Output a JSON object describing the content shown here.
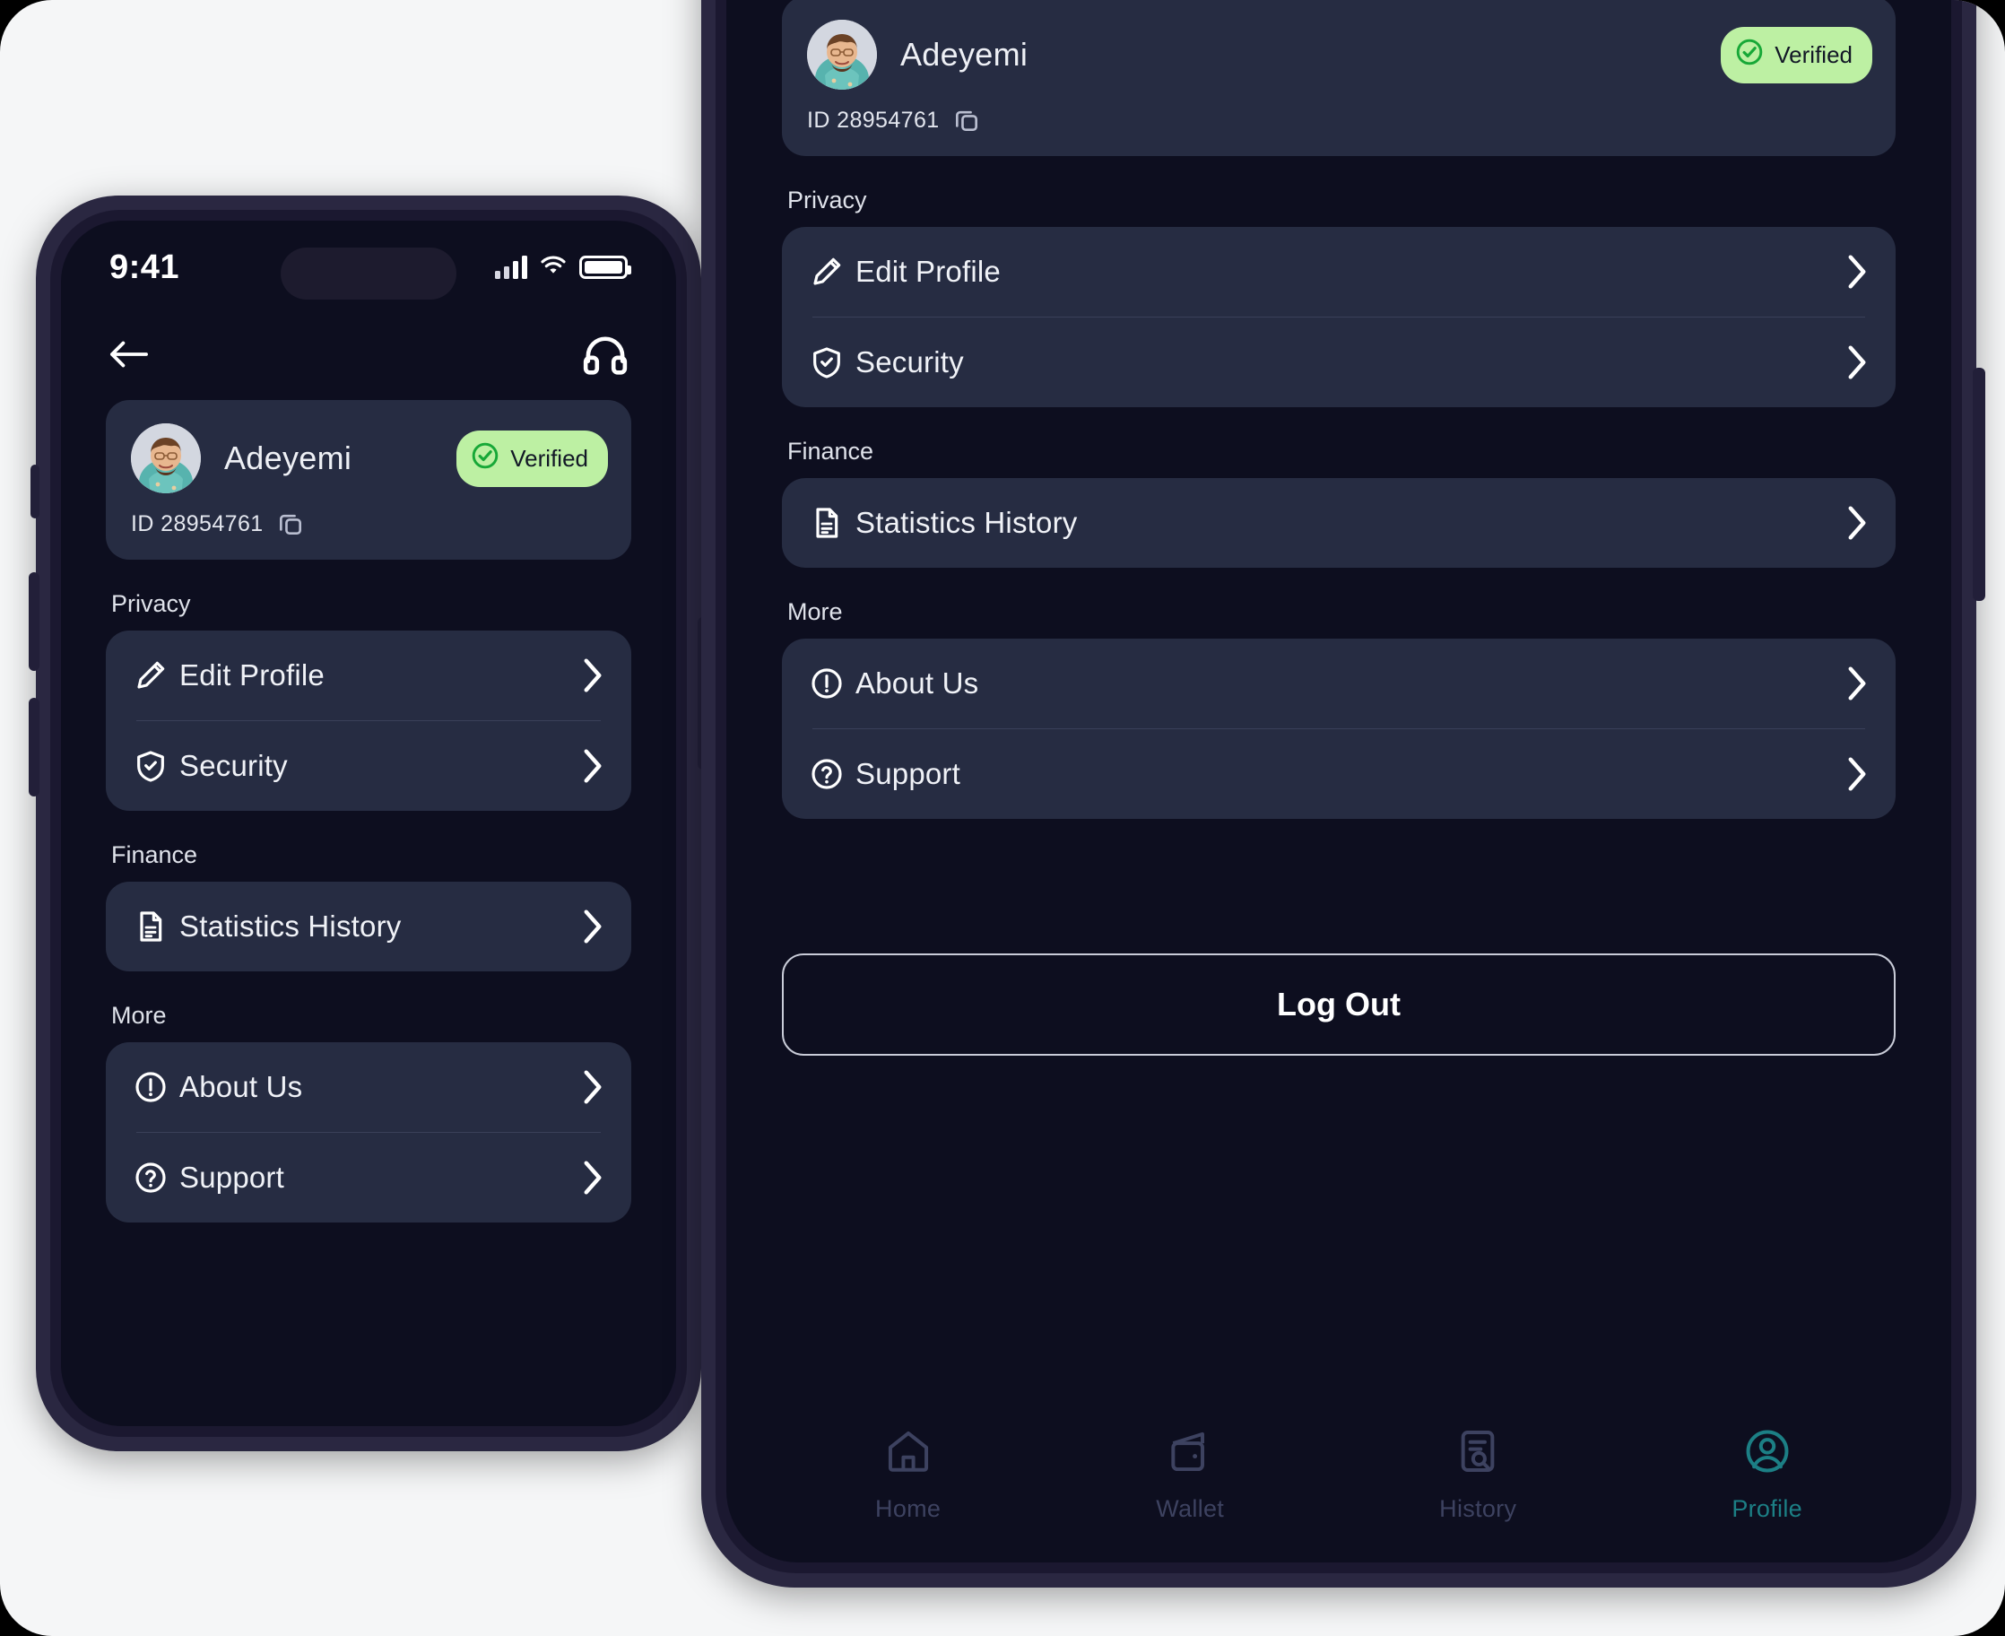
{
  "status_bar": {
    "time": "9:41",
    "signal_icon": "cellular-signal-icon",
    "wifi_icon": "wifi-icon",
    "battery_icon": "battery-icon"
  },
  "header": {
    "back_icon": "back-arrow-icon",
    "support_icon": "headphones-icon"
  },
  "profile": {
    "name": "Adeyemi",
    "id_label": "ID 28954761",
    "copy_icon": "copy-icon",
    "verified_label": "Verified",
    "verified_icon": "check-circle-icon",
    "avatar_icon": "user-avatar-photo"
  },
  "sections": [
    {
      "label": "Privacy",
      "items": [
        {
          "label": "Edit Profile",
          "icon": "pencil-icon",
          "chevron": "chevron-right-icon"
        },
        {
          "label": "Security",
          "icon": "shield-check-icon",
          "chevron": "chevron-right-icon"
        }
      ]
    },
    {
      "label": "Finance",
      "items": [
        {
          "label": "Statistics History",
          "icon": "document-icon",
          "chevron": "chevron-right-icon"
        }
      ]
    },
    {
      "label": "More",
      "items": [
        {
          "label": "About Us",
          "icon": "info-circle-icon",
          "chevron": "chevron-right-icon"
        },
        {
          "label": "Support",
          "icon": "question-circle-icon",
          "chevron": "chevron-right-icon"
        }
      ]
    }
  ],
  "logout": {
    "label": "Log Out"
  },
  "bottom_nav": {
    "items": [
      {
        "label": "Home",
        "icon": "home-icon",
        "active": false
      },
      {
        "label": "Wallet",
        "icon": "wallet-icon",
        "active": false
      },
      {
        "label": "History",
        "icon": "history-search-icon",
        "active": false
      },
      {
        "label": "Profile",
        "icon": "user-circle-icon",
        "active": true
      }
    ]
  },
  "colors": {
    "canvas_bg": "#f5f6f7",
    "phone_frame": "#2a2741",
    "screen_bg": "#0d0e1f",
    "card_bg": "#262c42",
    "verified_bg": "#bdf0a3",
    "verified_text": "#121726",
    "accent_active": "#1c7f85",
    "nav_inactive": "#3d4260",
    "divider": "#3a4059"
  }
}
